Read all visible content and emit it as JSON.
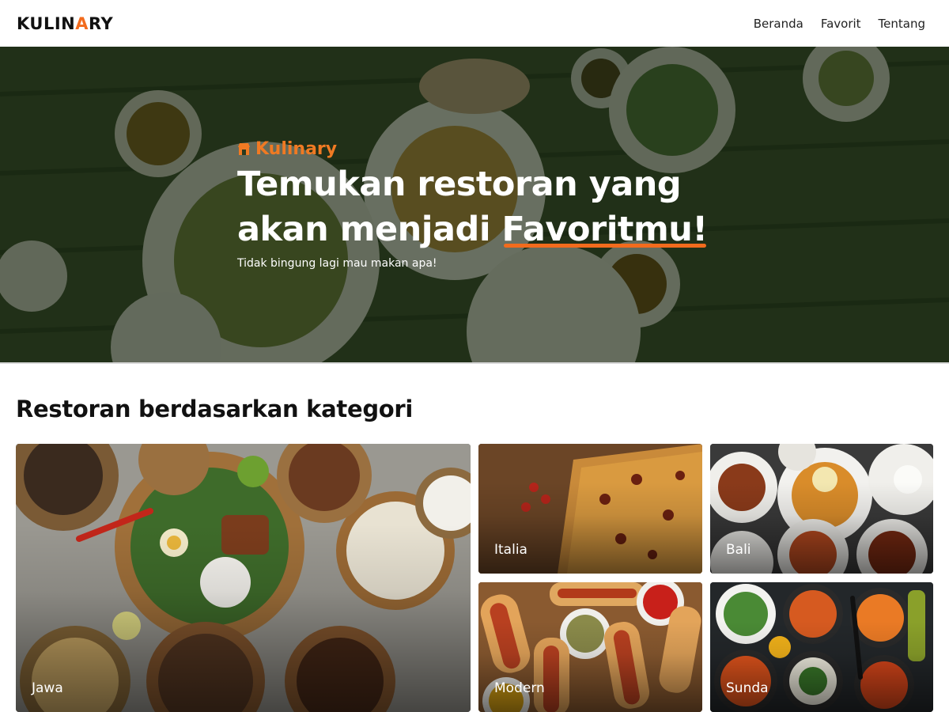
{
  "navbar": {
    "logo_prefix": "KULIN",
    "logo_accent": "A",
    "logo_suffix": "RY",
    "links": [
      {
        "label": "Beranda"
      },
      {
        "label": "Favorit"
      },
      {
        "label": "Tentang"
      }
    ]
  },
  "hero": {
    "brand_icon": "shop-icon",
    "brand": "Kulinary",
    "title_line1": "Temukan restoran yang",
    "title_line2_prefix": "akan menjadi ",
    "title_highlight": "Favoritmu!",
    "subtitle": "Tidak bingung lagi mau makan apa!"
  },
  "categories": {
    "title": "Restoran berdasarkan kategori",
    "items": [
      {
        "label": "Jawa"
      },
      {
        "label": "Italia"
      },
      {
        "label": "Bali"
      },
      {
        "label": "Modern"
      },
      {
        "label": "Sunda"
      }
    ]
  },
  "colors": {
    "accent": "#f26b1d",
    "hero_overlay": "#0c1c0a",
    "text_dark": "#111111"
  }
}
